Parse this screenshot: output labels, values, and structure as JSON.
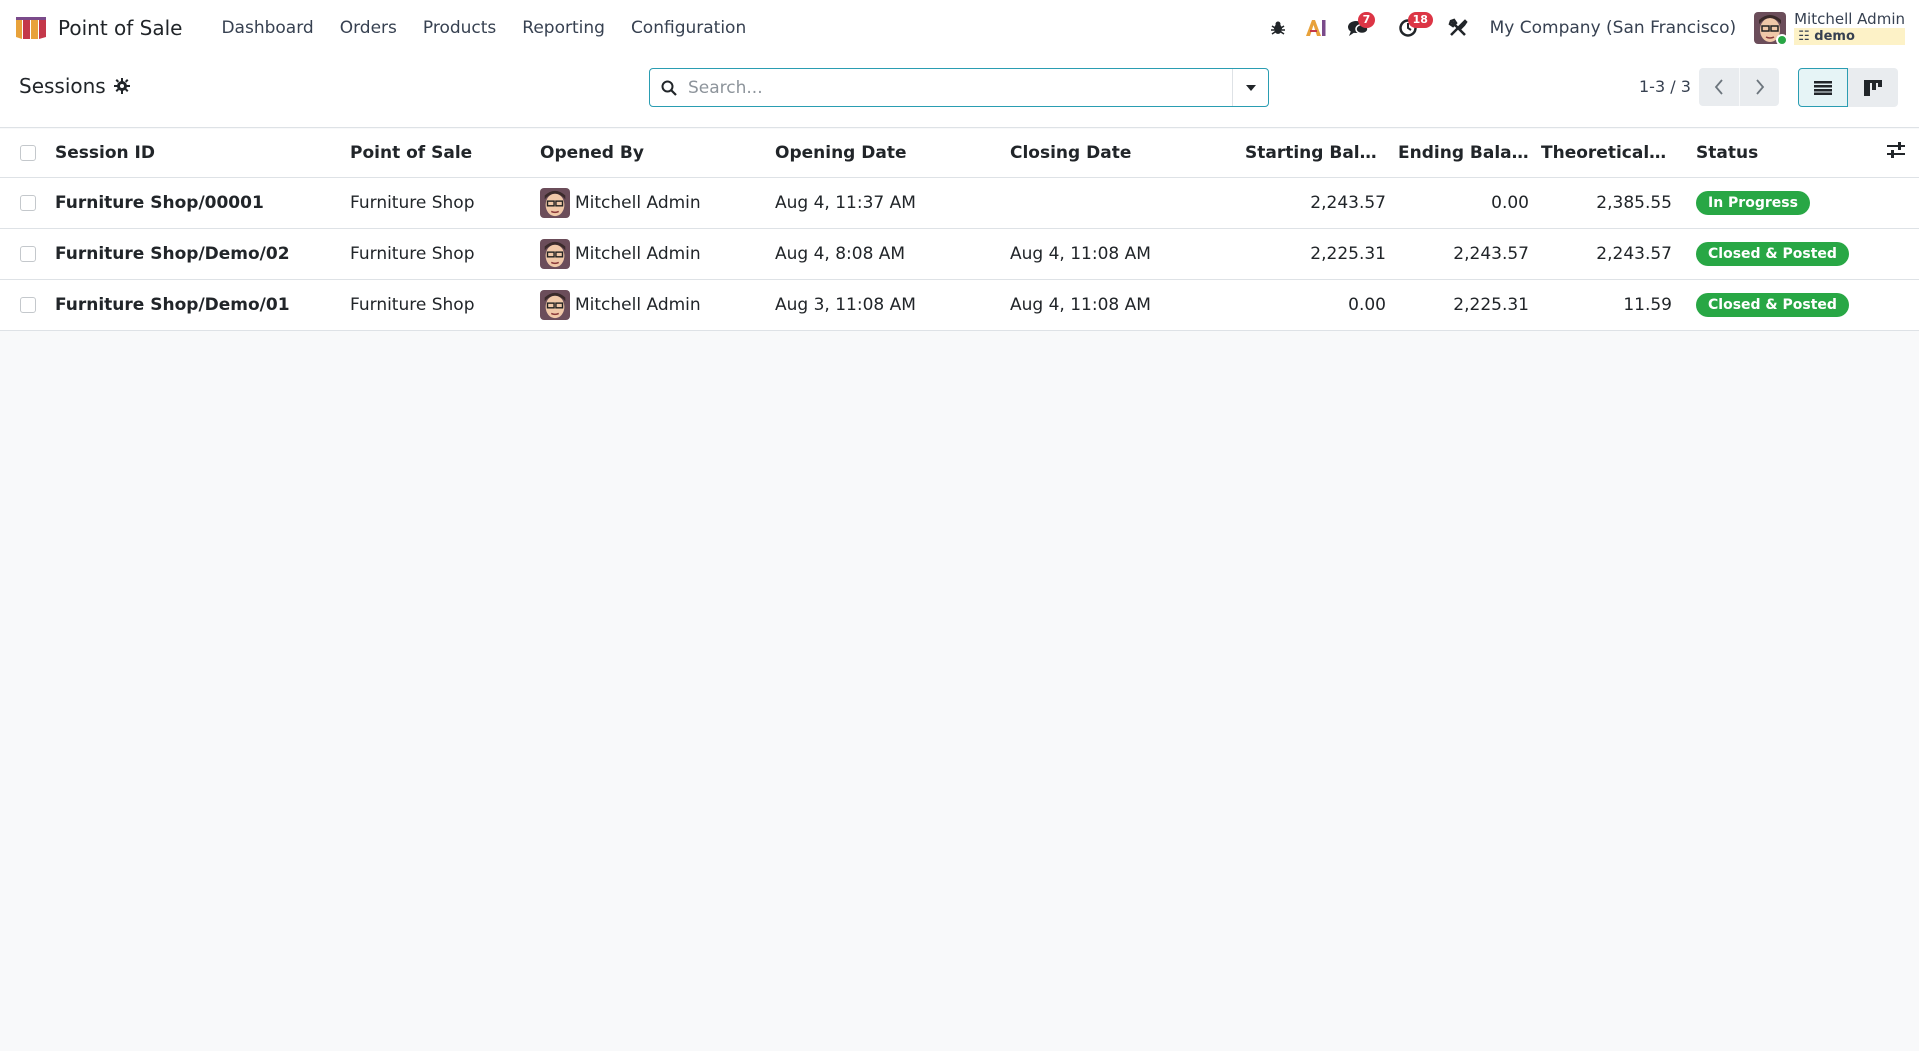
{
  "app": {
    "name": "Point of Sale",
    "menu": [
      "Dashboard",
      "Orders",
      "Products",
      "Reporting",
      "Configuration"
    ]
  },
  "systray": {
    "messages_count": "7",
    "activities_count": "18",
    "company": "My Company (San Francisco)",
    "user_name": "Mitchell Admin",
    "database": "demo"
  },
  "control_panel": {
    "title": "Sessions",
    "search_placeholder": "Search...",
    "pager": "1-3 / 3"
  },
  "table": {
    "columns": [
      "Session ID",
      "Point of Sale",
      "Opened By",
      "Opening Date",
      "Closing Date",
      "Starting Bala...",
      "Ending Balance",
      "Theoretical Cl...",
      "Status"
    ],
    "rows": [
      {
        "session_id": "Furniture Shop/00001",
        "pos": "Furniture Shop",
        "opened_by": "Mitchell Admin",
        "opening_date": "Aug 4, 11:37 AM",
        "closing_date": "",
        "starting_balance": "2,243.57",
        "ending_balance": "0.00",
        "theoretical_closing": "2,385.55",
        "status": "In Progress"
      },
      {
        "session_id": "Furniture Shop/Demo/02",
        "pos": "Furniture Shop",
        "opened_by": "Mitchell Admin",
        "opening_date": "Aug 4, 8:08 AM",
        "closing_date": "Aug 4, 11:08 AM",
        "starting_balance": "2,225.31",
        "ending_balance": "2,243.57",
        "theoretical_closing": "2,243.57",
        "status": "Closed & Posted"
      },
      {
        "session_id": "Furniture Shop/Demo/01",
        "pos": "Furniture Shop",
        "opened_by": "Mitchell Admin",
        "opening_date": "Aug 3, 11:08 AM",
        "closing_date": "Aug 4, 11:08 AM",
        "starting_balance": "0.00",
        "ending_balance": "2,225.31",
        "theoretical_closing": "11.59",
        "status": "Closed & Posted"
      }
    ]
  },
  "colors": {
    "status_success": "#28a745",
    "accent": "#2a9db2",
    "badge_danger": "#dc3545"
  },
  "icons": {
    "app_logo": "pos-shop-icon",
    "debug": "bug-icon",
    "ai": "ai-icon",
    "messages": "chat-icon",
    "activities": "clock-icon",
    "tools": "tools-icon",
    "settings": "gear-icon",
    "search": "search-icon",
    "dropdown": "caret-down-icon",
    "list_view": "list-icon",
    "kanban_view": "kanban-icon",
    "optional_columns": "sliders-icon"
  }
}
